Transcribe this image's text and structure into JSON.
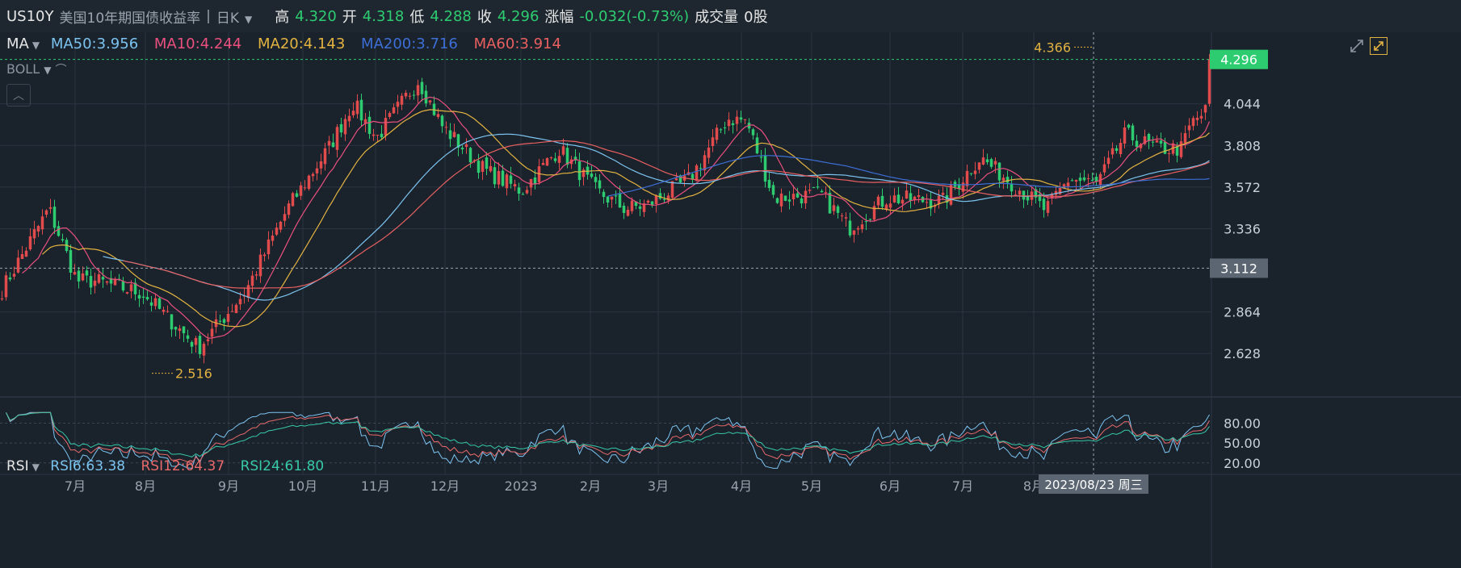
{
  "header": {
    "symbol": "US10Y",
    "name": "美国10年期国债收益率",
    "sep": "|",
    "period": "日K",
    "high_label": "高",
    "high": "4.320",
    "open_label": "开",
    "open": "4.318",
    "low_label": "低",
    "low": "4.288",
    "close_label": "收",
    "close": "4.296",
    "change_label": "涨幅",
    "change": "-0.032(-0.73%)",
    "volume_label": "成交量",
    "volume": "0股"
  },
  "ma_legend": {
    "title": "MA",
    "items": [
      {
        "text": "MA50:3.956",
        "color": "#7cc4f0"
      },
      {
        "text": "MA10:4.244",
        "color": "#e9507e"
      },
      {
        "text": "MA20:4.143",
        "color": "#e3b341"
      },
      {
        "text": "MA200:3.716",
        "color": "#3d6fd6"
      },
      {
        "text": "MA60:3.914",
        "color": "#e86060"
      }
    ]
  },
  "boll_label": "BOLL",
  "rsi_legend": {
    "title": "RSI",
    "items": [
      {
        "text": "RSI6:63.38",
        "color": "#7cc4f0"
      },
      {
        "text": "RSI12:64.37",
        "color": "#e86a6a"
      },
      {
        "text": "RSI24:61.80",
        "color": "#37c9a8"
      }
    ]
  },
  "colors": {
    "up": "#e14b4b",
    "down": "#2ecc71",
    "bg": "#1a222c",
    "grid": "#2a3542",
    "crosshair": "#9aa4ae"
  },
  "chart_data": {
    "type": "candlestick",
    "price_ticks": [
      "4.044",
      "3.808",
      "3.572",
      "3.336",
      "2.864",
      "2.628"
    ],
    "ylim": [
      2.4,
      4.45
    ],
    "x_labels": [
      "7月",
      "8月",
      "9月",
      "10月",
      "11月",
      "12月",
      "2023",
      "2月",
      "3月",
      "4月",
      "5月",
      "6月",
      "7月",
      "8月"
    ],
    "current_price": "4.296",
    "crosshair_price": "3.112",
    "high_marker": "4.366",
    "low_marker": "2.516",
    "crosshair_date": "2023/08/23 周三",
    "rsi_ticks": [
      "80.00",
      "50.00",
      "20.00"
    ],
    "rsi_ylim": [
      10,
      100
    ],
    "close_path": [
      [
        0,
        2.99
      ],
      [
        20,
        3.45
      ],
      [
        32,
        3.04
      ],
      [
        40,
        3.04
      ],
      [
        60,
        2.97
      ],
      [
        84,
        2.66
      ],
      [
        104,
        2.98
      ],
      [
        122,
        3.45
      ],
      [
        140,
        3.8
      ],
      [
        150,
        4.05
      ],
      [
        160,
        3.85
      ],
      [
        178,
        4.18
      ],
      [
        188,
        3.92
      ],
      [
        206,
        3.67
      ],
      [
        222,
        3.55
      ],
      [
        238,
        3.79
      ],
      [
        254,
        3.55
      ],
      [
        266,
        3.45
      ],
      [
        276,
        3.47
      ],
      [
        294,
        3.62
      ],
      [
        310,
        3.96
      ],
      [
        318,
        3.95
      ],
      [
        330,
        3.51
      ],
      [
        350,
        3.53
      ],
      [
        362,
        3.34
      ],
      [
        378,
        3.51
      ],
      [
        402,
        3.49
      ],
      [
        418,
        3.74
      ],
      [
        434,
        3.57
      ],
      [
        446,
        3.44
      ],
      [
        456,
        3.62
      ],
      [
        468,
        3.59
      ],
      [
        480,
        3.87
      ],
      [
        494,
        3.79
      ],
      [
        504,
        3.79
      ],
      [
        508,
        3.93
      ],
      [
        516,
        4.02
      ]
    ],
    "ma_periods": {
      "MA10": 10,
      "MA20": 20,
      "MA50": 50,
      "MA60": 60,
      "MA200": 200
    },
    "bar_count": 300
  }
}
